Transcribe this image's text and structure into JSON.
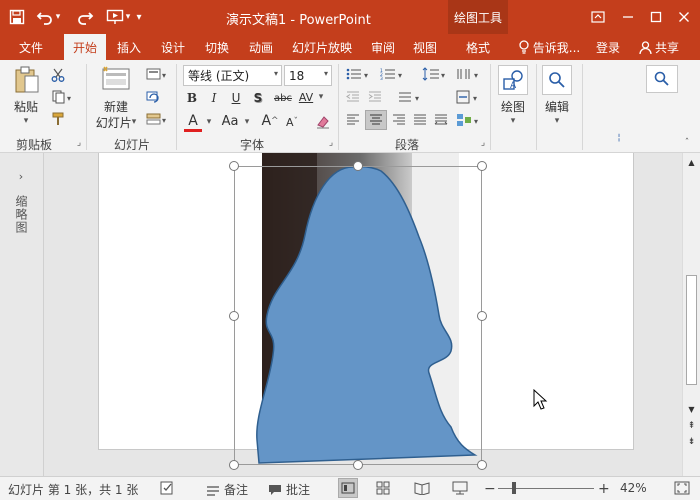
{
  "window": {
    "title": "演示文稿1 - PowerPoint",
    "context_tab": "绘图工具",
    "qat_dropdown": "▾"
  },
  "tabs": [
    "文件",
    "开始",
    "插入",
    "设计",
    "切换",
    "动画",
    "幻灯片放映",
    "审阅",
    "视图",
    "格式"
  ],
  "tell_me": "告诉我...",
  "login": "登录",
  "share": "共享",
  "ribbon": {
    "clipboard": {
      "label": "剪贴板",
      "paste": "粘贴"
    },
    "slides": {
      "label": "幻灯片",
      "new_slide_line1": "新建",
      "new_slide_line2": "幻灯片"
    },
    "font": {
      "label": "字体",
      "font_name": "等线 (正文)",
      "font_size": "18",
      "bold": "B",
      "italic": "I",
      "underline": "U",
      "shadow": "S",
      "strike": "abc",
      "spacing": "AV",
      "font_color": "A",
      "change_case": "Aa",
      "grow": "A",
      "shrink": "A"
    },
    "paragraph": {
      "label": "段落"
    },
    "drawing": {
      "label": "绘图"
    },
    "editing": {
      "label": "编辑"
    }
  },
  "thumb_pane": {
    "label": "缩略图"
  },
  "status": {
    "slide_info": "幻灯片 第 1 张，共 1 张",
    "notes": "备注",
    "comments": "批注",
    "zoom": "42%"
  },
  "colors": {
    "accent": "#c43e1c",
    "shape_fill": "#6495c7",
    "shape_stroke": "#2f5f8f"
  }
}
